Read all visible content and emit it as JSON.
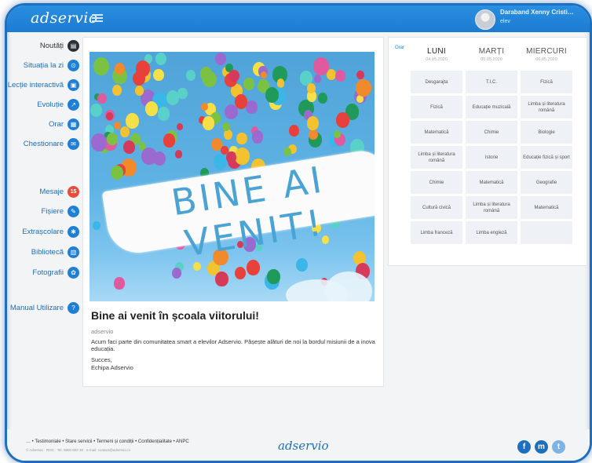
{
  "app": {
    "logo": "adservio",
    "footer_logo": "adservio"
  },
  "user": {
    "name": "Daraband Xenny Cristi…",
    "role": "elev"
  },
  "sidebar": {
    "items": [
      {
        "label": "Noutăți",
        "icon": "news-icon",
        "glyph": "▤"
      },
      {
        "label": "Situația la zi",
        "icon": "status-icon",
        "glyph": "⊙"
      },
      {
        "label": "Lecție interactivă",
        "icon": "lesson-icon",
        "glyph": "▣"
      },
      {
        "label": "Evoluție",
        "icon": "chart-icon",
        "glyph": "↗"
      },
      {
        "label": "Orar",
        "icon": "calendar-icon",
        "glyph": "▦"
      },
      {
        "label": "Chestionare",
        "icon": "quiz-icon",
        "glyph": "✉"
      },
      {
        "label": "Mesaje",
        "icon": "messages-icon",
        "glyph": "15"
      },
      {
        "label": "Fișiere",
        "icon": "files-icon",
        "glyph": "✎"
      },
      {
        "label": "Extrașcolare",
        "icon": "extracurricular-icon",
        "glyph": "✱"
      },
      {
        "label": "Bibliotecă",
        "icon": "library-icon",
        "glyph": "▥"
      },
      {
        "label": "Fotografii",
        "icon": "photos-icon",
        "glyph": "✿"
      },
      {
        "label": "Manual Utilizare",
        "icon": "help-icon",
        "glyph": "?"
      }
    ]
  },
  "post": {
    "banner": "BINE AI VENIT!",
    "title": "Bine ai venit în școala viitorului!",
    "author": "adservio",
    "body": "Acum faci parte din comunitatea smart a elevilor Adservio. Pășește alături de noi la bordul misiunii de a inova educația.",
    "sign1": "Succes,",
    "sign2": "Echipa Adservio"
  },
  "schedule": {
    "label": "Orar",
    "days": [
      {
        "name": "LUNI",
        "date": "04.05.2020"
      },
      {
        "name": "MARȚI",
        "date": "05.05.2020"
      },
      {
        "name": "MIERCURI",
        "date": "06.05.2020"
      }
    ],
    "rows": [
      [
        "Desgarajta",
        "T.I.C.",
        "Fizică"
      ],
      [
        "Fizică",
        "Educație muzicală",
        "Limba și literatura română"
      ],
      [
        "Matematică",
        "Chimie",
        "Biologie"
      ],
      [
        "Limba și literatura română",
        "Istorie",
        "Educație fizică și sport"
      ],
      [
        "Chimie",
        "Matematică",
        "Geografie"
      ],
      [
        "Cultură civică",
        "Limba și literatura română",
        "Matematică"
      ],
      [
        "Limba franceză",
        "Limba engleză",
        ""
      ]
    ]
  },
  "footer": {
    "links": "… • Testimoniale • Stare servicii • Termeni și condiții • Confidențialitate • ANPC",
    "small": "© Adservio · ROC · Tel. 0800 800 30 · e-mail: contact@adservio.ro"
  },
  "colors": {
    "brand": "#1f6fbf",
    "accent": "#1f7fd6",
    "badge": "#e74c3c"
  }
}
